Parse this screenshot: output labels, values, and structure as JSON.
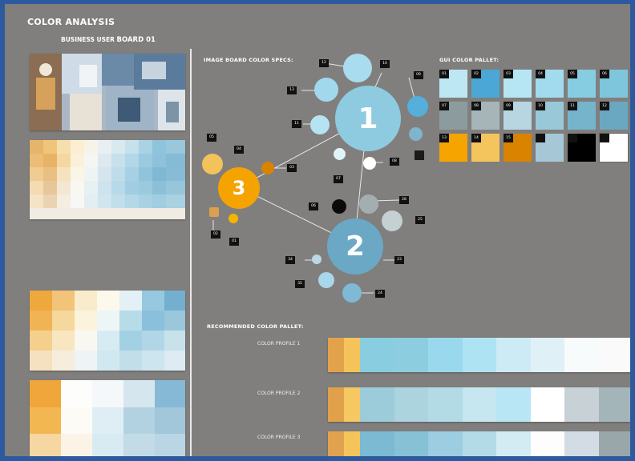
{
  "header": {
    "title": "COLOR ANALYSIS",
    "subtitle_a": "BUSINESS USER",
    "subtitle_b": "BOARD 01"
  },
  "labels": {
    "image_board_specs": "IMAGE BOARD COLOR SPECS:",
    "gui_color_pallet": "GUI COLOR PALLET:",
    "recommended_pallet": "RECOMMENDED COLOR PALLET:"
  },
  "nodes": {
    "n1": "1",
    "n2": "2",
    "n3": "3"
  },
  "gui_pallet": [
    {
      "tag": "01",
      "color": "#bde8f3"
    },
    {
      "tag": "02",
      "color": "#4aa7d6"
    },
    {
      "tag": "03",
      "color": "#b6e6f4"
    },
    {
      "tag": "04",
      "color": "#a2daee"
    },
    {
      "tag": "05",
      "color": "#86cde2"
    },
    {
      "tag": "06",
      "color": "#7dc6dc"
    },
    {
      "tag": "07",
      "color": "#8c9c9e"
    },
    {
      "tag": "08",
      "color": "#a6b6b8"
    },
    {
      "tag": "09",
      "color": "#b7d6e1"
    },
    {
      "tag": "10",
      "color": "#99c8d9"
    },
    {
      "tag": "11",
      "color": "#76b4cc"
    },
    {
      "tag": "12",
      "color": "#6aa7c0"
    },
    {
      "tag": "13",
      "color": "#f5a400"
    },
    {
      "tag": "14",
      "color": "#f4c55d"
    },
    {
      "tag": "15",
      "color": "#d98300"
    },
    {
      "tag": "",
      "color": "#a5c7d6"
    },
    {
      "tag": "",
      "color": "#000000"
    },
    {
      "tag": "",
      "color": "#ffffff"
    }
  ],
  "profiles": [
    {
      "label": "COLOR PROFILE 1",
      "colors": [
        "#e2a24b",
        "#f5c35a",
        "#88cde0",
        "#8ccde0",
        "#9ad8ee",
        "#aee3f4",
        "#cdebf5",
        "#dff1f7",
        "#f7fbfb",
        "#fafafa"
      ]
    },
    {
      "label": "COLOR PROFILE 2",
      "colors": [
        "#e0a14a",
        "#f5c862",
        "#9ccbda",
        "#acd4df",
        "#b2dbe6",
        "#c6e6f0",
        "#b9e6f5",
        "#ffffff",
        "#c7d1d6",
        "#a3b5b8"
      ]
    },
    {
      "label": "COLOR PROFILE 3",
      "colors": [
        "#e0a24e",
        "#f5c55c",
        "#7cb9d2",
        "#86c1d6",
        "#9ccde0",
        "#b2dbe7",
        "#d3ebf3",
        "#fdfdfd",
        "#d3dbe5",
        "#9aa7aa"
      ]
    }
  ],
  "node_labels": [
    "12",
    "13",
    "11",
    "10",
    "09",
    "08",
    "07",
    "06",
    "05",
    "04",
    "03",
    "02",
    "01",
    "28",
    "25",
    "34",
    "35",
    "23",
    "24",
    "22",
    "21",
    "20",
    "19",
    "18"
  ]
}
